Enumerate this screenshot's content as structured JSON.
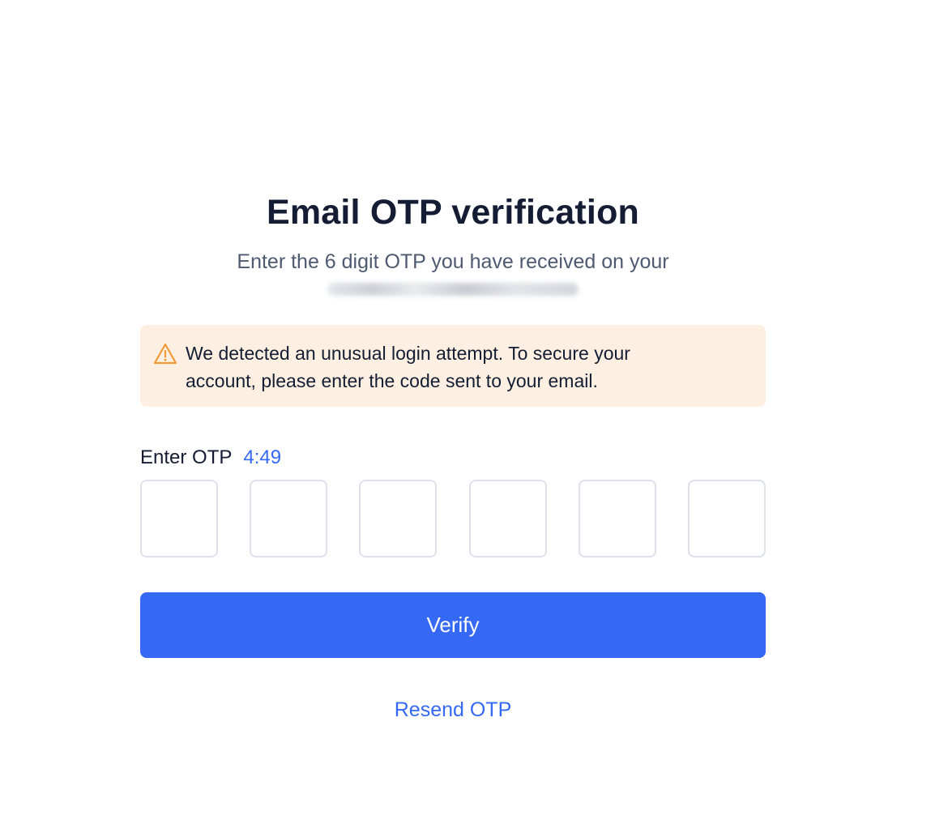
{
  "header": {
    "title": "Email OTP verification",
    "subtitle": "Enter the 6 digit OTP you have received on your"
  },
  "alert": {
    "icon": "warning-icon",
    "text": "We detected an unusual login attempt. To secure your account, please enter the code sent to your email.",
    "background": "#fdf0e2",
    "icon_color": "#f29a38"
  },
  "otp": {
    "label": "Enter OTP",
    "timer": "4:49",
    "boxes": [
      "",
      "",
      "",
      "",
      "",
      ""
    ]
  },
  "actions": {
    "verify_label": "Verify",
    "resend_label": "Resend OTP"
  },
  "colors": {
    "accent": "#3468f5",
    "heading": "#141d33",
    "muted": "#4e5a70",
    "box_border": "#dde1ea"
  }
}
